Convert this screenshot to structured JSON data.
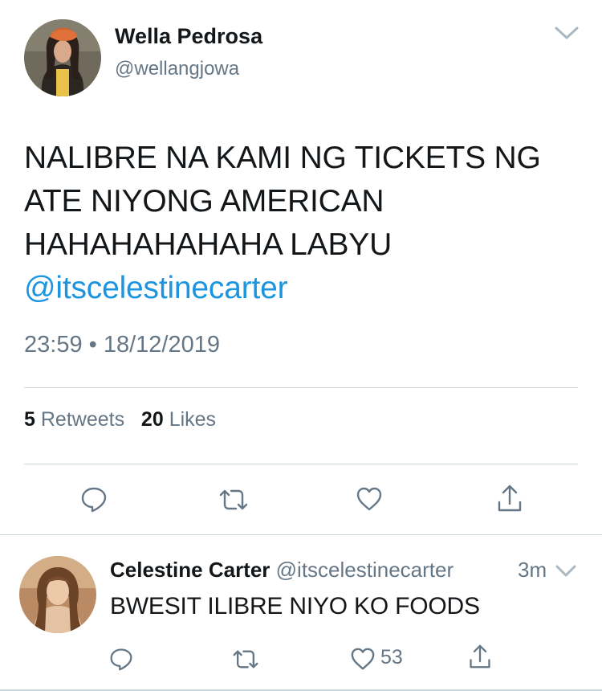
{
  "main_tweet": {
    "author_name": "Wella Pedrosa",
    "author_handle": "@wellangjowa",
    "text_lines": [
      "NALIBRE NA KAMI NG TICKETS NG",
      "ATE NIYONG AMERICAN",
      "HAHAHAHAHAHA LABYU"
    ],
    "mention": "@itscelestinecarter",
    "time": "23:59",
    "separator": "•",
    "date": "18/12/2019",
    "retweet_count": "5",
    "retweet_label": "Retweets",
    "like_count": "20",
    "like_label": "Likes"
  },
  "reply": {
    "author_name": "Celestine Carter",
    "author_handle": "@itscelestinecarter",
    "time_ago": "3m",
    "text": "BWESIT ILIBRE NIYO KO FOODS",
    "like_count": "53"
  },
  "icons": {
    "reply": "reply-icon",
    "retweet": "retweet-icon",
    "like": "heart-icon",
    "share": "share-icon",
    "menu": "chevron-down-icon"
  },
  "colors": {
    "text": "#14171a",
    "secondary": "#657786",
    "link": "#1b95e0",
    "divider": "#ccd6dd",
    "icon": "#657786"
  }
}
